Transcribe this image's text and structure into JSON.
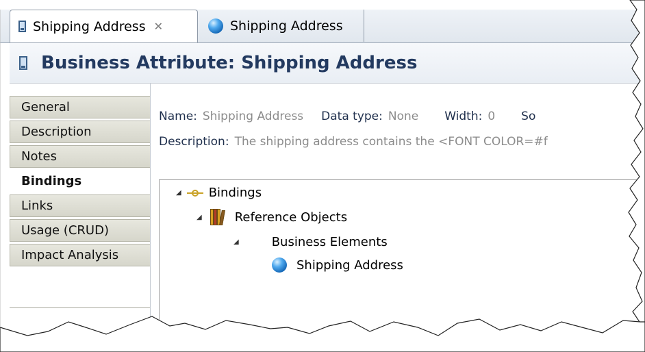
{
  "editor_tabs": [
    {
      "label": "Shipping Address",
      "icon": "document-icon",
      "active": true,
      "close": "✕"
    },
    {
      "label": "Shipping Address",
      "icon": "blue-ball-icon",
      "active": false
    }
  ],
  "editor_title": "Business Attribute: Shipping Address",
  "sidebar": {
    "items": [
      {
        "label": "General"
      },
      {
        "label": "Description"
      },
      {
        "label": "Notes"
      },
      {
        "label": "Bindings",
        "selected": true
      },
      {
        "label": "Links"
      },
      {
        "label": "Usage (CRUD)"
      },
      {
        "label": "Impact Analysis"
      }
    ]
  },
  "properties": {
    "name_label": "Name:",
    "name_value": "Shipping Address",
    "datatype_label": "Data type:",
    "datatype_value": "None",
    "width_label": "Width:",
    "width_value": "0",
    "cut_label": "So",
    "description_label": "Description:",
    "description_value": "The shipping address contains the <FONT COLOR=#f"
  },
  "tree": {
    "nodes": [
      {
        "label": "Bindings",
        "icon": "binding-icon",
        "expanded": true
      },
      {
        "label": "Reference Objects",
        "icon": "books-icon",
        "expanded": true
      },
      {
        "label": "Business Elements",
        "icon": "",
        "expanded": true
      },
      {
        "label": "Shipping Address",
        "icon": "blue-ball-icon"
      }
    ]
  },
  "colors": {
    "title_text": "#233a60",
    "label_text": "#1f2f4c",
    "value_text": "#8c8c8c",
    "tab_strip": "#e1e7ee",
    "sidebar_tab": "#d6d6cb"
  }
}
